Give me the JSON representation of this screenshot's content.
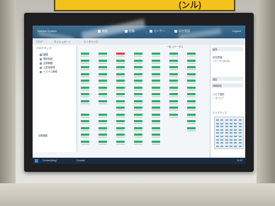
{
  "photo": {
    "sign_text": "(ンル)",
    "bezel_color": "#1f1f22",
    "sign_color": "#f5c21b"
  },
  "app": {
    "title_bar": {
      "app_name": "Toshiba System",
      "nav": [
        "機器",
        "設備",
        "センサー",
        "設定管理"
      ],
      "user": "Logout"
    },
    "breadcrumb": [
      "フロア",
      "ダッシュボード",
      "モニタリング"
    ],
    "tree": {
      "header": "フロアマップ",
      "items": [
        "全体",
        "照明系統",
        "空調機器",
        "入退室管理",
        "システム管理"
      ],
      "footer": "全機器数"
    },
    "grid_toolbar": "一覧  ステータス",
    "status_colors": {
      "ok": "#2fae6a",
      "alert": "#d9423d"
    },
    "right_panel": {
      "header": "操作",
      "section1_title": "状況詳細",
      "section1_text": "ステータス表示中",
      "section2_title": "設定",
      "section3_title": "詳細設定",
      "section4_title": "フロア選択",
      "section4_value": "ー 全フロア",
      "minimap_title": "エリアマップ"
    },
    "taskbar": {
      "tasks": [
        "Console(Mng)",
        "Console"
      ],
      "clock": "11:00"
    }
  }
}
